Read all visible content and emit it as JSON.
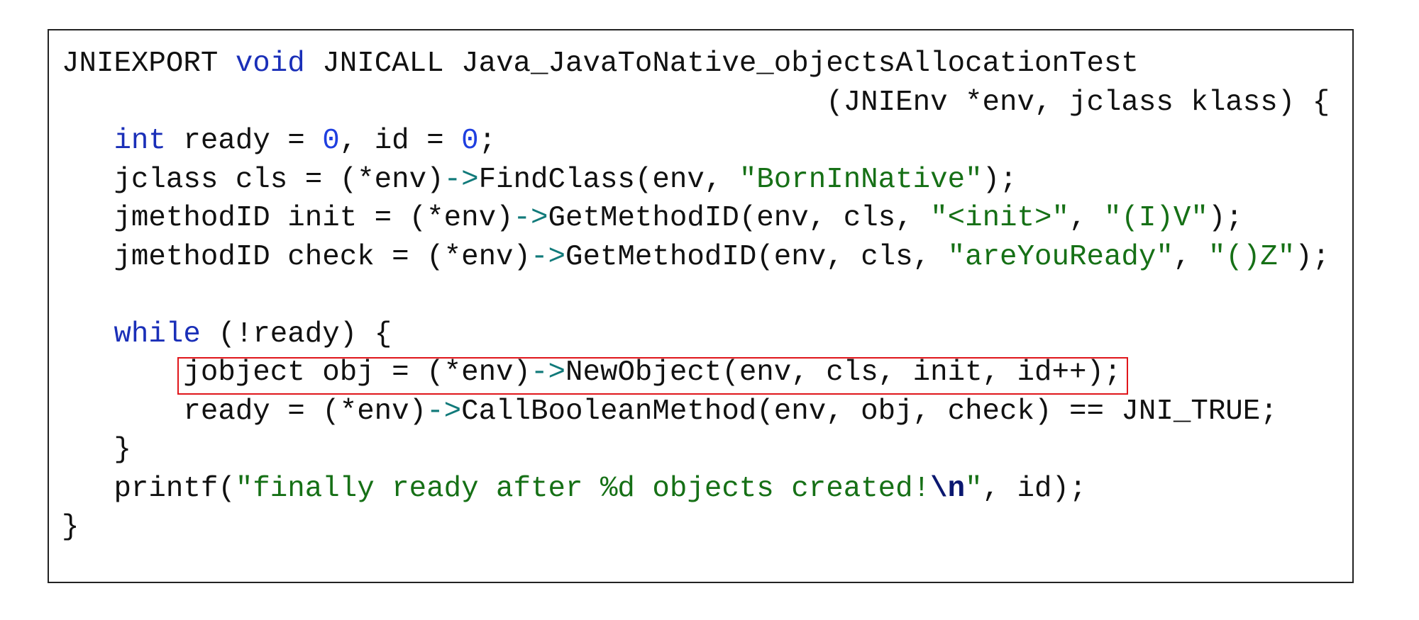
{
  "colors": {
    "keyword": "#1a2fb8",
    "number": "#1f3fe0",
    "string": "#167016",
    "operator": "#117a7a",
    "escape": "#0b1870",
    "highlight_box": "#e0161b"
  },
  "code": {
    "highlighted_line_index": 8,
    "lines": [
      [
        [
          "JNIEXPORT ",
          ""
        ],
        [
          "void",
          "kw"
        ],
        [
          " JNICALL Java_JavaToNative_objectsAllocationTest",
          ""
        ]
      ],
      [
        [
          "                                            (JNIEnv *env, jclass klass) {",
          ""
        ]
      ],
      [
        [
          "   ",
          ""
        ],
        [
          "int",
          "kw"
        ],
        [
          " ready = ",
          ""
        ],
        [
          "0",
          "num"
        ],
        [
          ", id = ",
          ""
        ],
        [
          "0",
          "num"
        ],
        [
          ";",
          ""
        ]
      ],
      [
        [
          "   jclass cls = (*env)",
          ""
        ],
        [
          "->",
          "op"
        ],
        [
          "FindClass(env, ",
          ""
        ],
        [
          "\"BornInNative\"",
          "str"
        ],
        [
          ");",
          ""
        ]
      ],
      [
        [
          "   jmethodID init = (*env)",
          ""
        ],
        [
          "->",
          "op"
        ],
        [
          "GetMethodID(env, cls, ",
          ""
        ],
        [
          "\"<init>\"",
          "str"
        ],
        [
          ", ",
          ""
        ],
        [
          "\"(I)V\"",
          "str"
        ],
        [
          ");",
          ""
        ]
      ],
      [
        [
          "   jmethodID check = (*env)",
          ""
        ],
        [
          "->",
          "op"
        ],
        [
          "GetMethodID(env, cls, ",
          ""
        ],
        [
          "\"areYouReady\"",
          "str"
        ],
        [
          ", ",
          ""
        ],
        [
          "\"()Z\"",
          "str"
        ],
        [
          ");",
          ""
        ]
      ],
      [],
      [
        [
          "   ",
          ""
        ],
        [
          "while",
          "kw"
        ],
        [
          " (!ready) {",
          ""
        ]
      ],
      [
        [
          "       jobject obj = (*env)",
          ""
        ],
        [
          "->",
          "op"
        ],
        [
          "NewObject(env, cls, init, id++);",
          ""
        ]
      ],
      [
        [
          "       ready = (*env)",
          ""
        ],
        [
          "->",
          "op"
        ],
        [
          "CallBooleanMethod(env, obj, check) == JNI_TRUE;",
          ""
        ]
      ],
      [
        [
          "   }",
          ""
        ]
      ],
      [
        [
          "   printf(",
          ""
        ],
        [
          "\"finally ready after %d objects created!",
          "str"
        ],
        [
          "\\n",
          "esc"
        ],
        [
          "\"",
          "str"
        ],
        [
          ", id);",
          ""
        ]
      ],
      [
        [
          "}",
          ""
        ]
      ]
    ]
  }
}
